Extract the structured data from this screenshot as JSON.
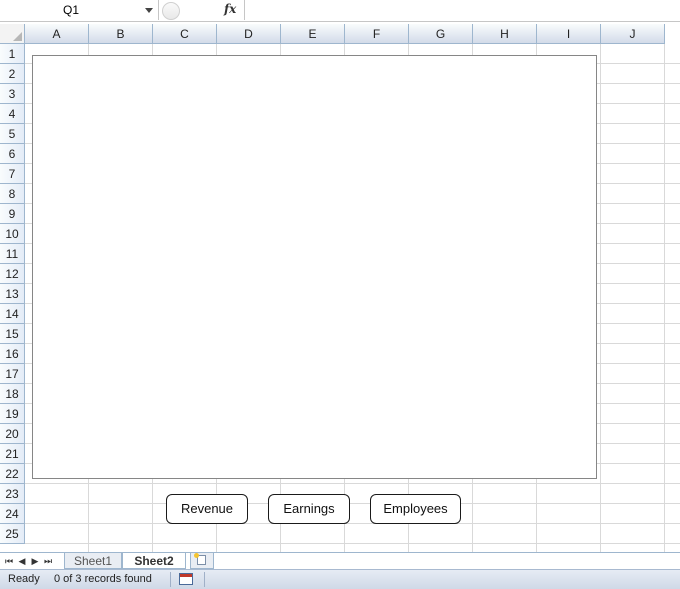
{
  "formula_bar": {
    "name_box": "Q1",
    "fx_label": "fx",
    "formula": ""
  },
  "columns": [
    "A",
    "B",
    "C",
    "D",
    "E",
    "F",
    "G",
    "H",
    "I",
    "J"
  ],
  "rows": [
    "1",
    "2",
    "3",
    "4",
    "5",
    "6",
    "7",
    "8",
    "9",
    "10",
    "11",
    "12",
    "13",
    "14",
    "15",
    "16",
    "17",
    "18",
    "19",
    "20",
    "21",
    "22",
    "23",
    "24",
    "25"
  ],
  "buttons": {
    "revenue": "Revenue",
    "earnings": "Earnings",
    "employees": "Employees"
  },
  "sheet_tabs": {
    "sheet1": "Sheet1",
    "sheet2": "Sheet2",
    "active": "Sheet2"
  },
  "status_bar": {
    "ready": "Ready",
    "records": "0 of 3 records found"
  }
}
